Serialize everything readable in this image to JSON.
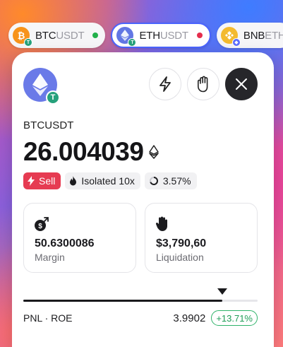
{
  "tickers": [
    {
      "base": "BTC",
      "quote": "USDT",
      "coin_icon": "bitcoin-icon",
      "status_color": "#22b04b",
      "active": false
    },
    {
      "base": "ETH",
      "quote": "USDT",
      "coin_icon": "ethereum-icon",
      "status_color": "#e52e4d",
      "active": true
    },
    {
      "base": "BNB",
      "quote": "ETH",
      "coin_icon": "bnb-icon",
      "status_color": "",
      "active": false
    }
  ],
  "card": {
    "pair_name": "BTCUSDT",
    "price": "26.004039",
    "actions": [
      "lightning-icon",
      "hand-icon",
      "close-icon"
    ],
    "tags": {
      "side": "Sell",
      "margin_mode": "Isolated 10x",
      "percent": "3.57%"
    },
    "stats": {
      "margin": {
        "value": "50.6300086",
        "label": "Margin"
      },
      "liquidation": {
        "value": "$3,790,60",
        "label": "Liquidation"
      }
    },
    "progress": 0.85,
    "pnl": {
      "label": "PNL · ROE",
      "value": "3.9902",
      "roe": "+13.71%"
    }
  },
  "colors": {
    "accent": "#4a64ff",
    "sell": "#e63b52",
    "positive": "#1f9d57",
    "tether": "#26a17b",
    "ethereum": "#6a7ae8"
  }
}
